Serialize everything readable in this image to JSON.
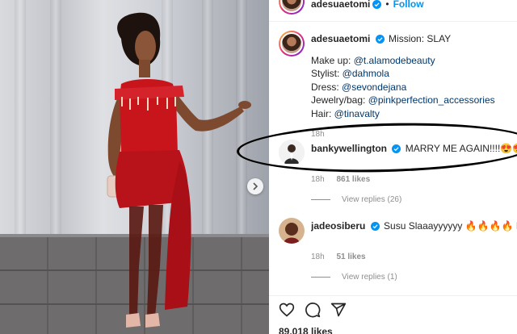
{
  "header": {
    "username": "adesuaetomi",
    "follow_label": "Follow",
    "separator": "•"
  },
  "caption": {
    "username": "adesuaetomi",
    "text": "Mission: SLAY",
    "credits": [
      {
        "label": "Make up: ",
        "mention": "@t.alamodebeauty"
      },
      {
        "label": "Stylist: ",
        "mention": "@dahmola"
      },
      {
        "label": "Dress: ",
        "mention": "@sevondejana"
      },
      {
        "label": "Jewelry/bag: ",
        "mention": "@pinkperfection_accessories"
      },
      {
        "label": "Hair: ",
        "mention": "@tinavalty"
      }
    ],
    "time": "18h"
  },
  "comments": [
    {
      "username": "bankywellington",
      "text": "MARRY ME AGAIN!!!!😍😍😍😍😍",
      "time": "18h",
      "likes": "861 likes",
      "view_replies": "View replies (26)"
    },
    {
      "username": "jadeosiberu",
      "text": "Susu Slaaayyyyyy 🔥🔥🔥🔥 Best in 😍😍😍",
      "time": "18h",
      "likes": "51 likes",
      "view_replies": "View replies (1)"
    }
  ],
  "actions": {
    "likes_count": "89,018 likes"
  },
  "colors": {
    "link": "#0095f6",
    "mention": "#00376b",
    "verified": "#0095f6",
    "muted": "#8e8e8e",
    "dress": "#c8151b"
  }
}
